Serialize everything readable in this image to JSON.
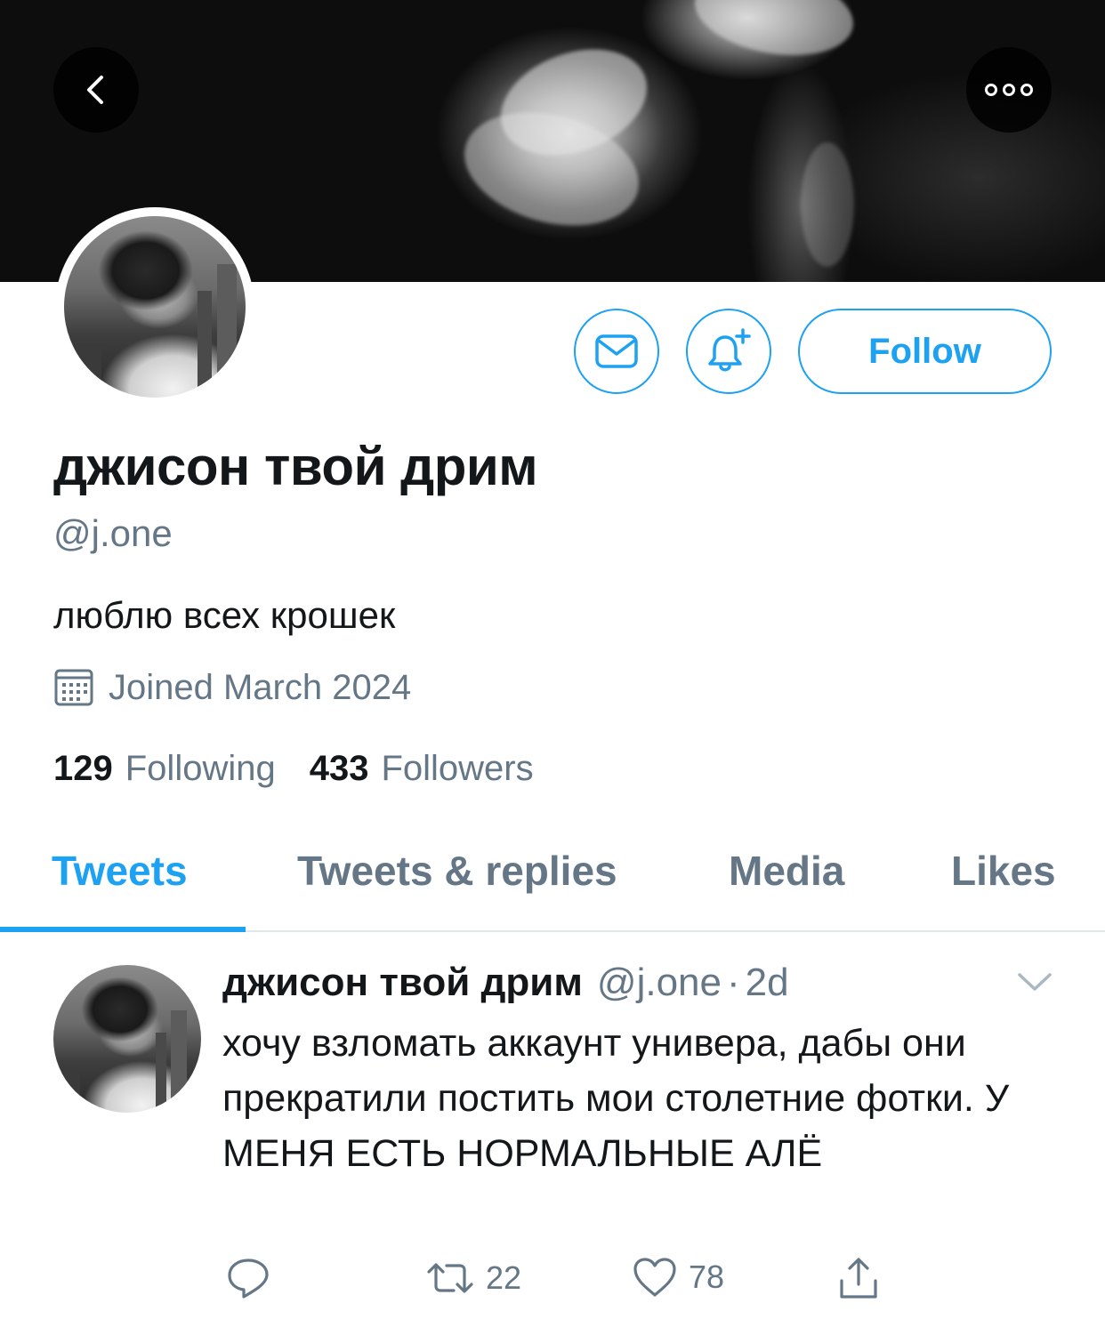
{
  "header": {
    "back_icon": "chevron-left-icon",
    "more_icon": "more-horizontal-icon"
  },
  "profile": {
    "display_name": "джисон твой дрим",
    "handle": "@j.one",
    "bio": "люблю всех крошек",
    "joined": "Joined March 2024",
    "following_count": "129",
    "following_label": "Following",
    "followers_count": "433",
    "followers_label": "Followers"
  },
  "actions": {
    "message_icon": "envelope-icon",
    "notify_icon": "bell-plus-icon",
    "follow_label": "Follow"
  },
  "tabs": [
    {
      "label": "Tweets",
      "active": true
    },
    {
      "label": "Tweets & replies",
      "active": false
    },
    {
      "label": "Media",
      "active": false
    },
    {
      "label": "Likes",
      "active": false
    }
  ],
  "tweet": {
    "name": "джисон твой дрим",
    "handle": "@j.one",
    "separator": "·",
    "time": "2d",
    "text": "хочу взломать аккаунт универа, дабы они прекратили постить мои столетние фотки. У МЕНЯ ЕСТЬ НОРМАЛЬНЫЕ АЛЁ",
    "reply_count": "",
    "retweet_count": "22",
    "like_count": "78"
  },
  "colors": {
    "accent": "#1da1f2",
    "secondary_text": "#657786",
    "primary_text": "#14171a",
    "divider": "#e1e8ed"
  }
}
